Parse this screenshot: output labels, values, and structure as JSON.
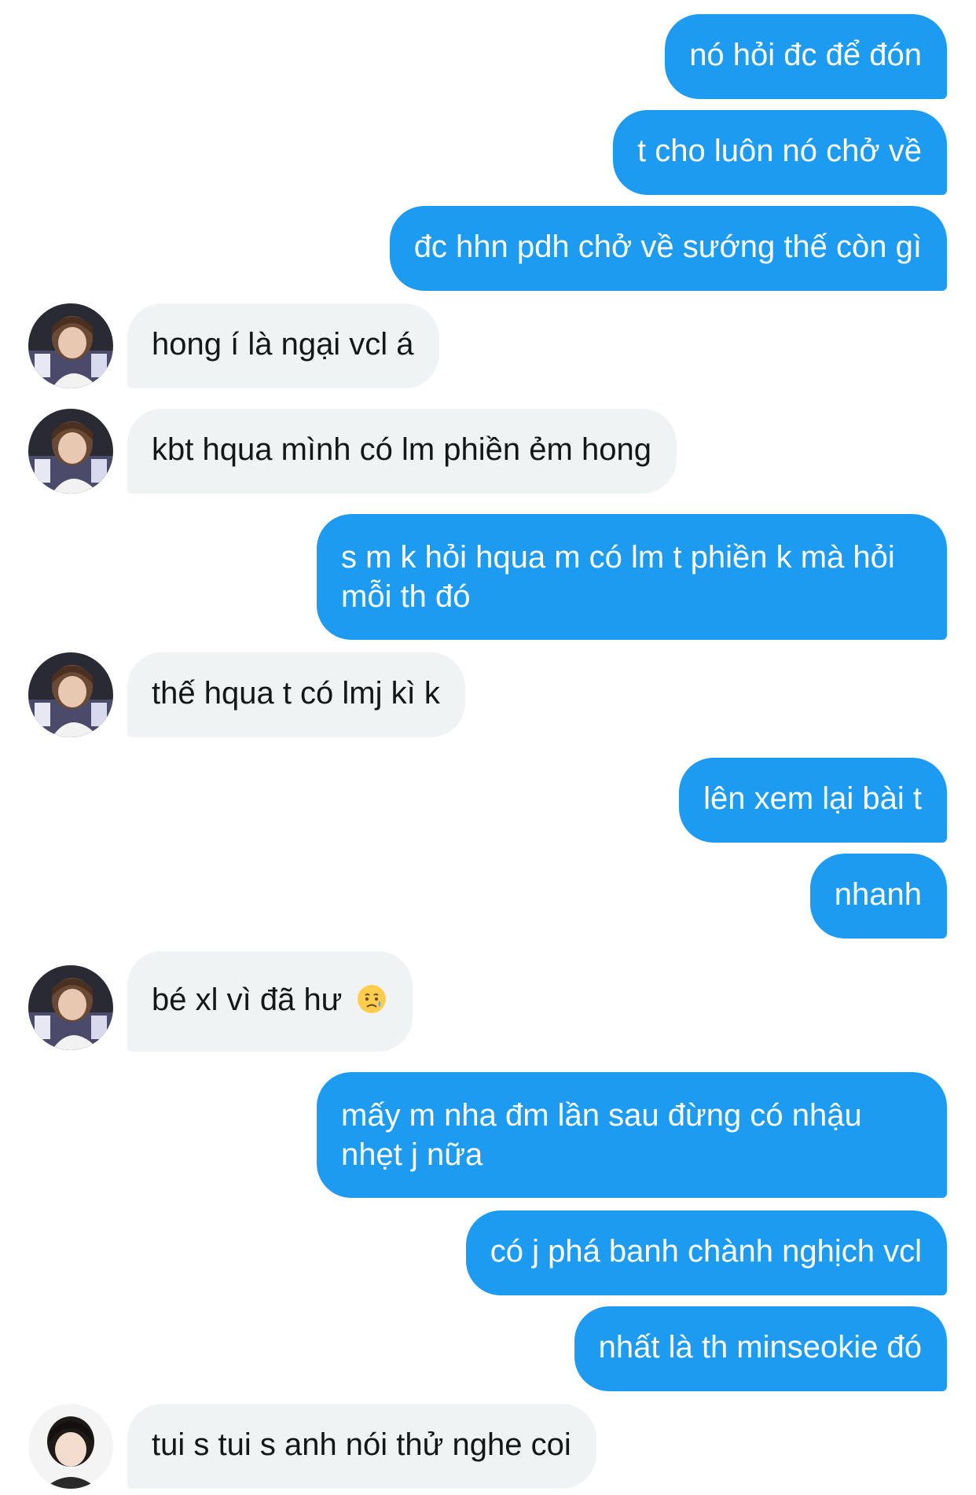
{
  "conversation": {
    "messages": [
      {
        "direction": "out",
        "text": "nó hỏi đc để đón"
      },
      {
        "direction": "out",
        "text": "t cho luôn nó chở về"
      },
      {
        "direction": "out",
        "text": "đc hhn pdh chở về sướng thế còn gì"
      },
      {
        "direction": "in",
        "text": "hong í là ngại vcl á"
      },
      {
        "direction": "in",
        "text": "kbt hqua mình có lm phiền ẻm hong"
      },
      {
        "direction": "out",
        "text": "s m k hỏi hqua m có lm t phiền k mà hỏi mỗi th đó"
      },
      {
        "direction": "in",
        "text": "thế hqua t có lmj kì k"
      },
      {
        "direction": "out",
        "text": "lên xem lại bài t"
      },
      {
        "direction": "out",
        "text": "nhanh"
      },
      {
        "direction": "in",
        "text": "bé xl vì đã hư",
        "emoji": "sad-relieved-face-emoji"
      },
      {
        "direction": "out",
        "text": "mấy m nha đm lần sau đừng có nhậu nhẹt j nữa"
      },
      {
        "direction": "out",
        "text": "có j phá banh chành nghịch vcl"
      },
      {
        "direction": "out",
        "text": "nhất là th minseokie đó"
      },
      {
        "direction": "in",
        "text": "tui s tui s anh nói thử nghe coi"
      }
    ]
  },
  "colors": {
    "outgoing_bubble": "#1d9bf0",
    "incoming_bubble": "#eff3f4",
    "incoming_text": "#14171a",
    "outgoing_text": "#ffffff"
  }
}
